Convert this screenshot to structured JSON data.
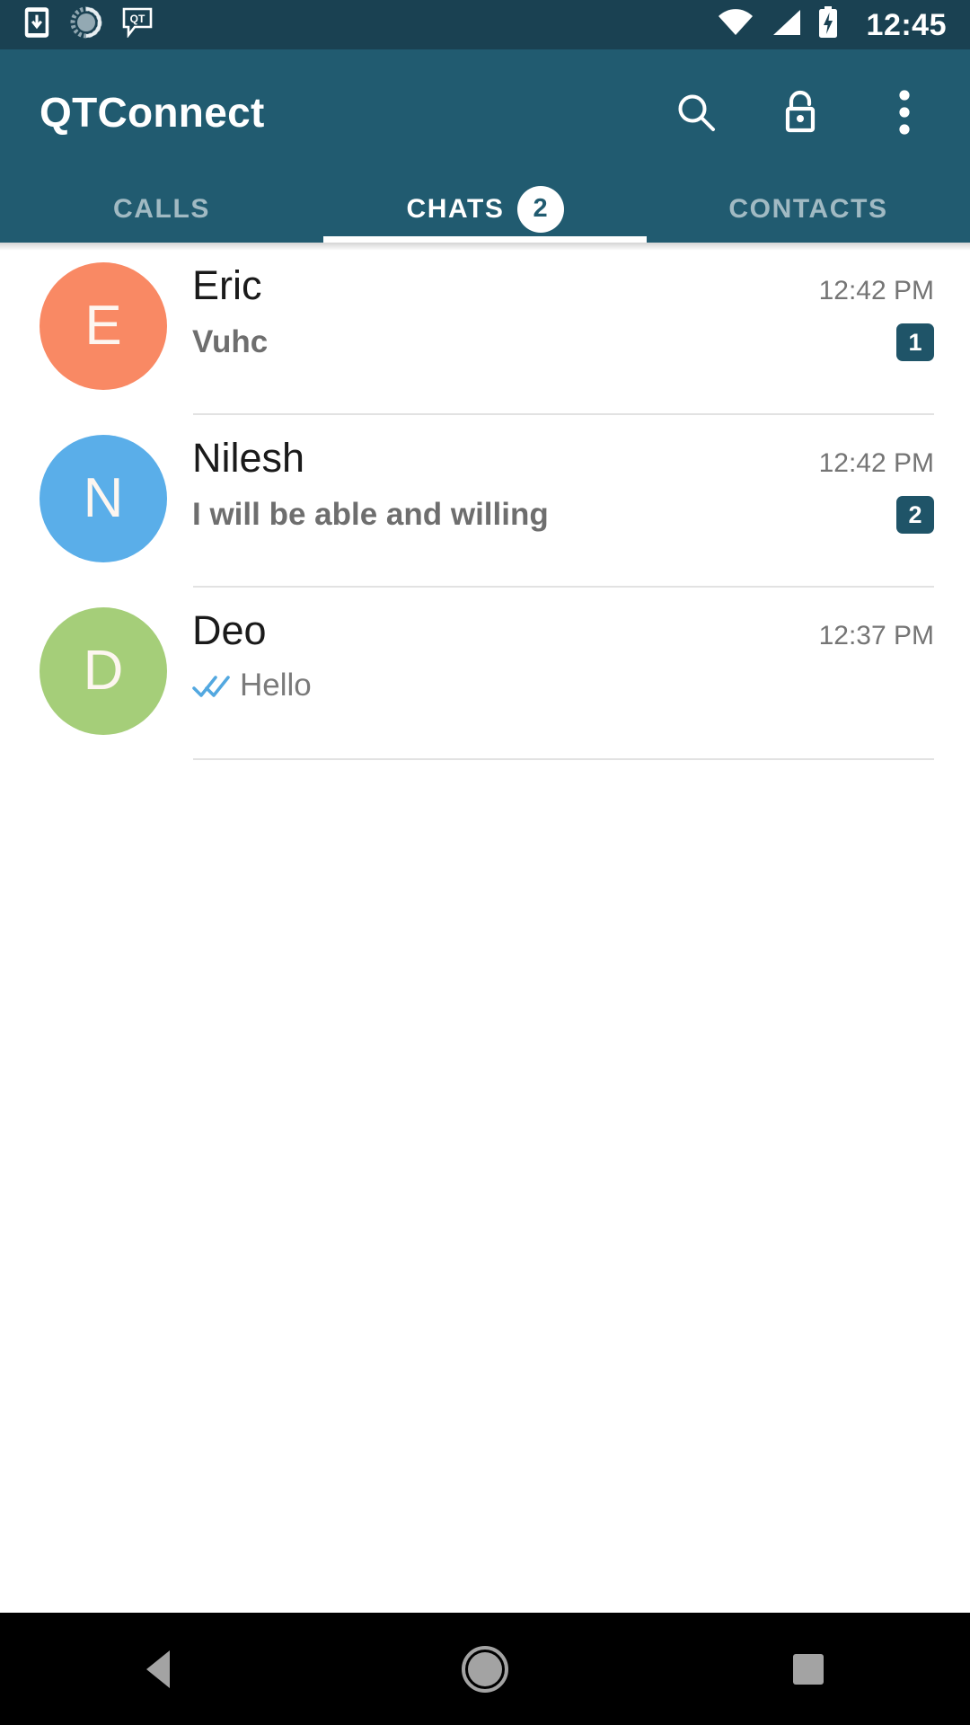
{
  "status_bar": {
    "time": "12:45",
    "left_icons": [
      "download-to-device-icon",
      "sync-spinner-icon",
      "qt-message-icon"
    ],
    "right_icons": [
      "wifi-icon",
      "cellular-signal-icon",
      "battery-charging-icon"
    ],
    "background_color": "#1a4152"
  },
  "app_bar": {
    "title": "QTConnect",
    "background_color": "#215b70",
    "actions": [
      {
        "name": "search-icon",
        "label": "Search"
      },
      {
        "name": "unlock-icon",
        "label": "Unlock"
      },
      {
        "name": "overflow-menu-icon",
        "label": "More options"
      }
    ]
  },
  "tabs": {
    "active_index": 1,
    "items": [
      {
        "label": "CALLS",
        "badge": ""
      },
      {
        "label": "CHATS",
        "badge": "2"
      },
      {
        "label": "CONTACTS",
        "badge": ""
      }
    ]
  },
  "chat_list": [
    {
      "name": "Eric",
      "initial": "E",
      "avatar_color": "#f98964",
      "snippet": "Vuhc",
      "unread": true,
      "time": "12:42 PM",
      "badge": "1",
      "read_receipt": ""
    },
    {
      "name": "Nilesh",
      "initial": "N",
      "avatar_color": "#5aaee9",
      "snippet": "I will be able and willing",
      "unread": true,
      "time": "12:42 PM",
      "badge": "2",
      "read_receipt": ""
    },
    {
      "name": "Deo",
      "initial": "D",
      "avatar_color": "#a5ce79",
      "snippet": "Hello",
      "unread": false,
      "time": "12:37 PM",
      "badge": "",
      "read_receipt": "double-check-read-icon"
    }
  ],
  "nav_bar": {
    "background_color": "#000000",
    "buttons": [
      {
        "name": "back-button",
        "label": "Back"
      },
      {
        "name": "home-button",
        "label": "Home"
      },
      {
        "name": "recents-button",
        "label": "Recents"
      }
    ]
  },
  "colors": {
    "accent": "#215b70",
    "status_bar": "#1a4152",
    "badge": "#1f5468",
    "read_receipt": "#53a8e0"
  }
}
